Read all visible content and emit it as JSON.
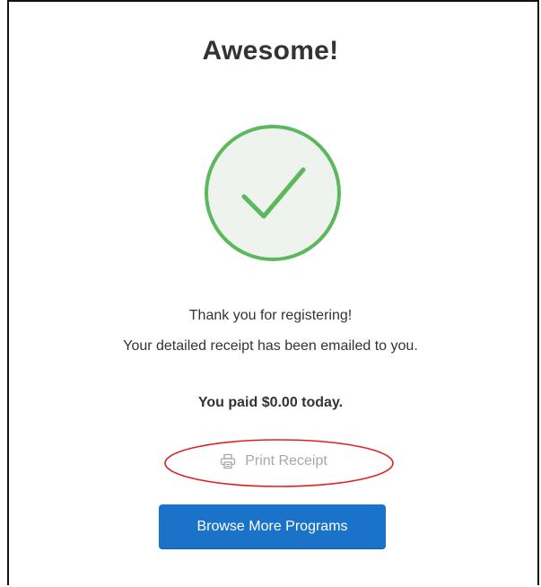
{
  "confirmation": {
    "title": "Awesome!",
    "success_icon": "check-circle-icon",
    "message_line_1": "Thank you for registering!",
    "message_line_2": "Your detailed receipt has been emailed to you.",
    "payment_summary": "You paid $0.00 today.",
    "print_receipt": {
      "icon": "printer-icon",
      "label": "Print Receipt"
    },
    "browse_button_label": "Browse More Programs"
  },
  "colors": {
    "success_green": "#5cb85c",
    "success_fill": "#eef3ee",
    "primary_blue": "#1a73c9",
    "muted_gray": "#a8a8a8",
    "highlight_red": "#e02020",
    "text": "#333333"
  }
}
